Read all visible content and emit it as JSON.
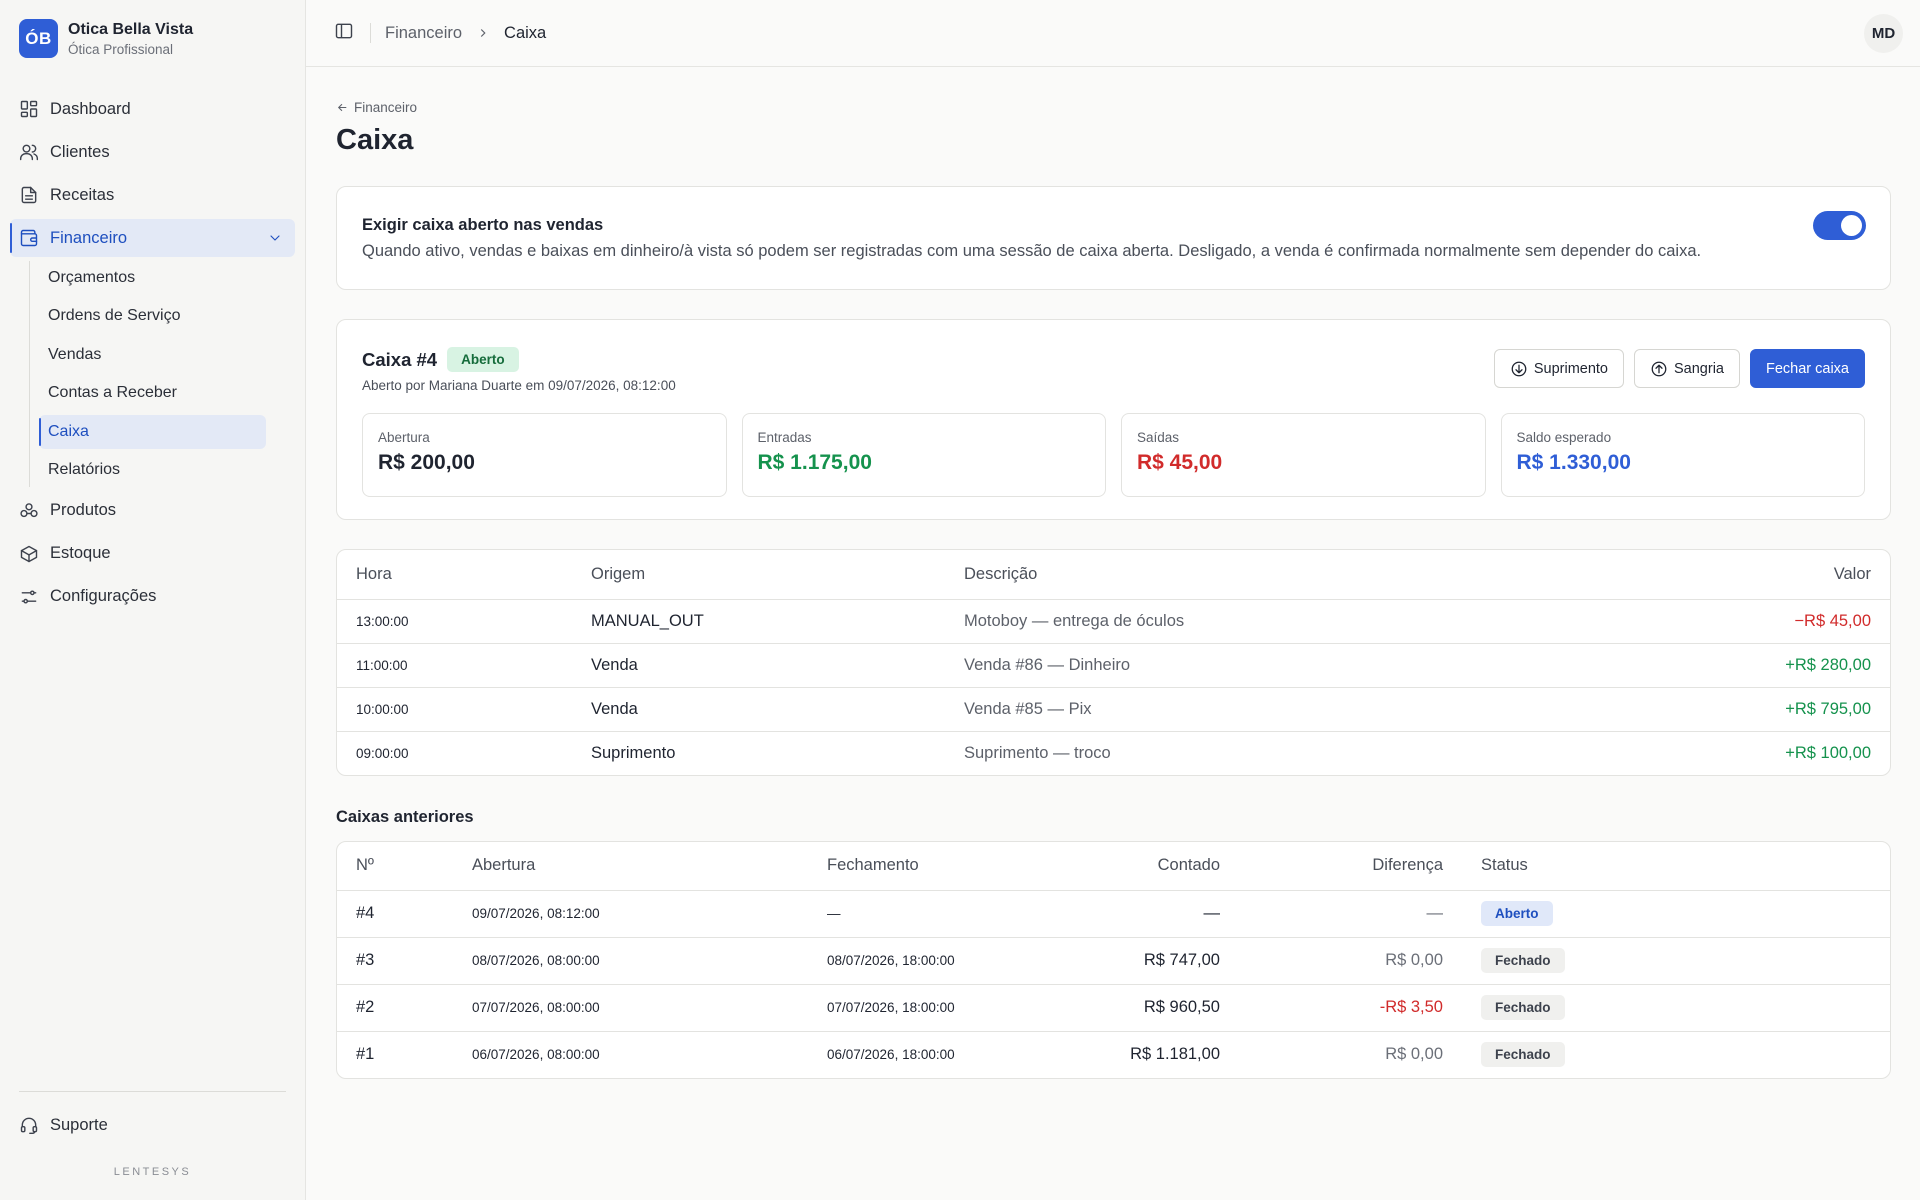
{
  "brand": {
    "initials": "ÓB",
    "name": "Otica Bella Vista",
    "subtitle": "Ótica Profissional",
    "color": "#2f5ed6"
  },
  "sidebar": {
    "items": [
      {
        "label": "Dashboard",
        "icon": "dashboard-icon"
      },
      {
        "label": "Clientes",
        "icon": "users-icon"
      },
      {
        "label": "Receitas",
        "icon": "document-icon"
      },
      {
        "label": "Financeiro",
        "icon": "wallet-icon",
        "active": true,
        "expanded": true
      },
      {
        "label": "Produtos",
        "icon": "glasses-icon"
      },
      {
        "label": "Estoque",
        "icon": "box-icon"
      },
      {
        "label": "Configurações",
        "icon": "settings-icon"
      }
    ],
    "financeiro_sub": [
      {
        "label": "Orçamentos"
      },
      {
        "label": "Ordens de Serviço"
      },
      {
        "label": "Vendas"
      },
      {
        "label": "Contas a Receber"
      },
      {
        "label": "Caixa",
        "active": true
      },
      {
        "label": "Relatórios"
      }
    ],
    "support_label": "Suporte",
    "footer": "LENTESYS"
  },
  "topbar": {
    "breadcrumb": [
      "Financeiro",
      "Caixa"
    ],
    "user_initials": "MD"
  },
  "page": {
    "back_label": "Financeiro",
    "title": "Caixa"
  },
  "setting": {
    "title": "Exigir caixa aberto nas vendas",
    "description": "Quando ativo, vendas e baixas em dinheiro/à vista só podem ser registradas com uma sessão de caixa aberta. Desligado, a venda é confirmada normalmente sem depender do caixa.",
    "enabled": true
  },
  "session": {
    "title": "Caixa #4",
    "status": "Aberto",
    "subtitle": "Aberto por Mariana Duarte em 09/07/2026, 08:12:00",
    "actions": {
      "suprimento": "Suprimento",
      "sangria": "Sangria",
      "fechar": "Fechar caixa"
    },
    "stats": [
      {
        "label": "Abertura",
        "value": "R$ 200,00",
        "color": "#1f2430"
      },
      {
        "label": "Entradas",
        "value": "R$ 1.175,00",
        "color": "#15924d"
      },
      {
        "label": "Saídas",
        "value": "R$ 45,00",
        "color": "#d12b2b"
      },
      {
        "label": "Saldo esperado",
        "value": "R$ 1.330,00",
        "color": "#2f5ed6"
      }
    ]
  },
  "movements": {
    "headers": {
      "hora": "Hora",
      "origem": "Origem",
      "descricao": "Descrição",
      "valor": "Valor"
    },
    "rows": [
      {
        "hora": "13:00:00",
        "origem": "MANUAL_OUT",
        "descricao": "Motoboy — entrega de óculos",
        "valor": "−R$ 45,00",
        "type": "out"
      },
      {
        "hora": "11:00:00",
        "origem": "Venda",
        "descricao": "Venda #86 — Dinheiro",
        "valor": "+R$ 280,00",
        "type": "in"
      },
      {
        "hora": "10:00:00",
        "origem": "Venda",
        "descricao": "Venda #85 — Pix",
        "valor": "+R$ 795,00",
        "type": "in"
      },
      {
        "hora": "09:00:00",
        "origem": "Suprimento",
        "descricao": "Suprimento — troco",
        "valor": "+R$ 100,00",
        "type": "in"
      }
    ]
  },
  "previous": {
    "title": "Caixas anteriores",
    "headers": {
      "num": "Nº",
      "abertura": "Abertura",
      "fechamento": "Fechamento",
      "contado": "Contado",
      "diferenca": "Diferença",
      "status": "Status"
    },
    "rows": [
      {
        "num": "#4",
        "abertura": "09/07/2026, 08:12:00",
        "fechamento": "—",
        "contado": "—",
        "diferenca": "—",
        "status": "Aberto",
        "diff_type": "none"
      },
      {
        "num": "#3",
        "abertura": "08/07/2026, 08:00:00",
        "fechamento": "08/07/2026, 18:00:00",
        "contado": "R$ 747,00",
        "diferenca": "R$ 0,00",
        "status": "Fechado",
        "diff_type": "zero"
      },
      {
        "num": "#2",
        "abertura": "07/07/2026, 08:00:00",
        "fechamento": "07/07/2026, 18:00:00",
        "contado": "R$ 960,50",
        "diferenca": "-R$ 3,50",
        "status": "Fechado",
        "diff_type": "neg"
      },
      {
        "num": "#1",
        "abertura": "06/07/2026, 08:00:00",
        "fechamento": "06/07/2026, 18:00:00",
        "contado": "R$ 1.181,00",
        "diferenca": "R$ 0,00",
        "status": "Fechado",
        "diff_type": "zero"
      }
    ]
  }
}
